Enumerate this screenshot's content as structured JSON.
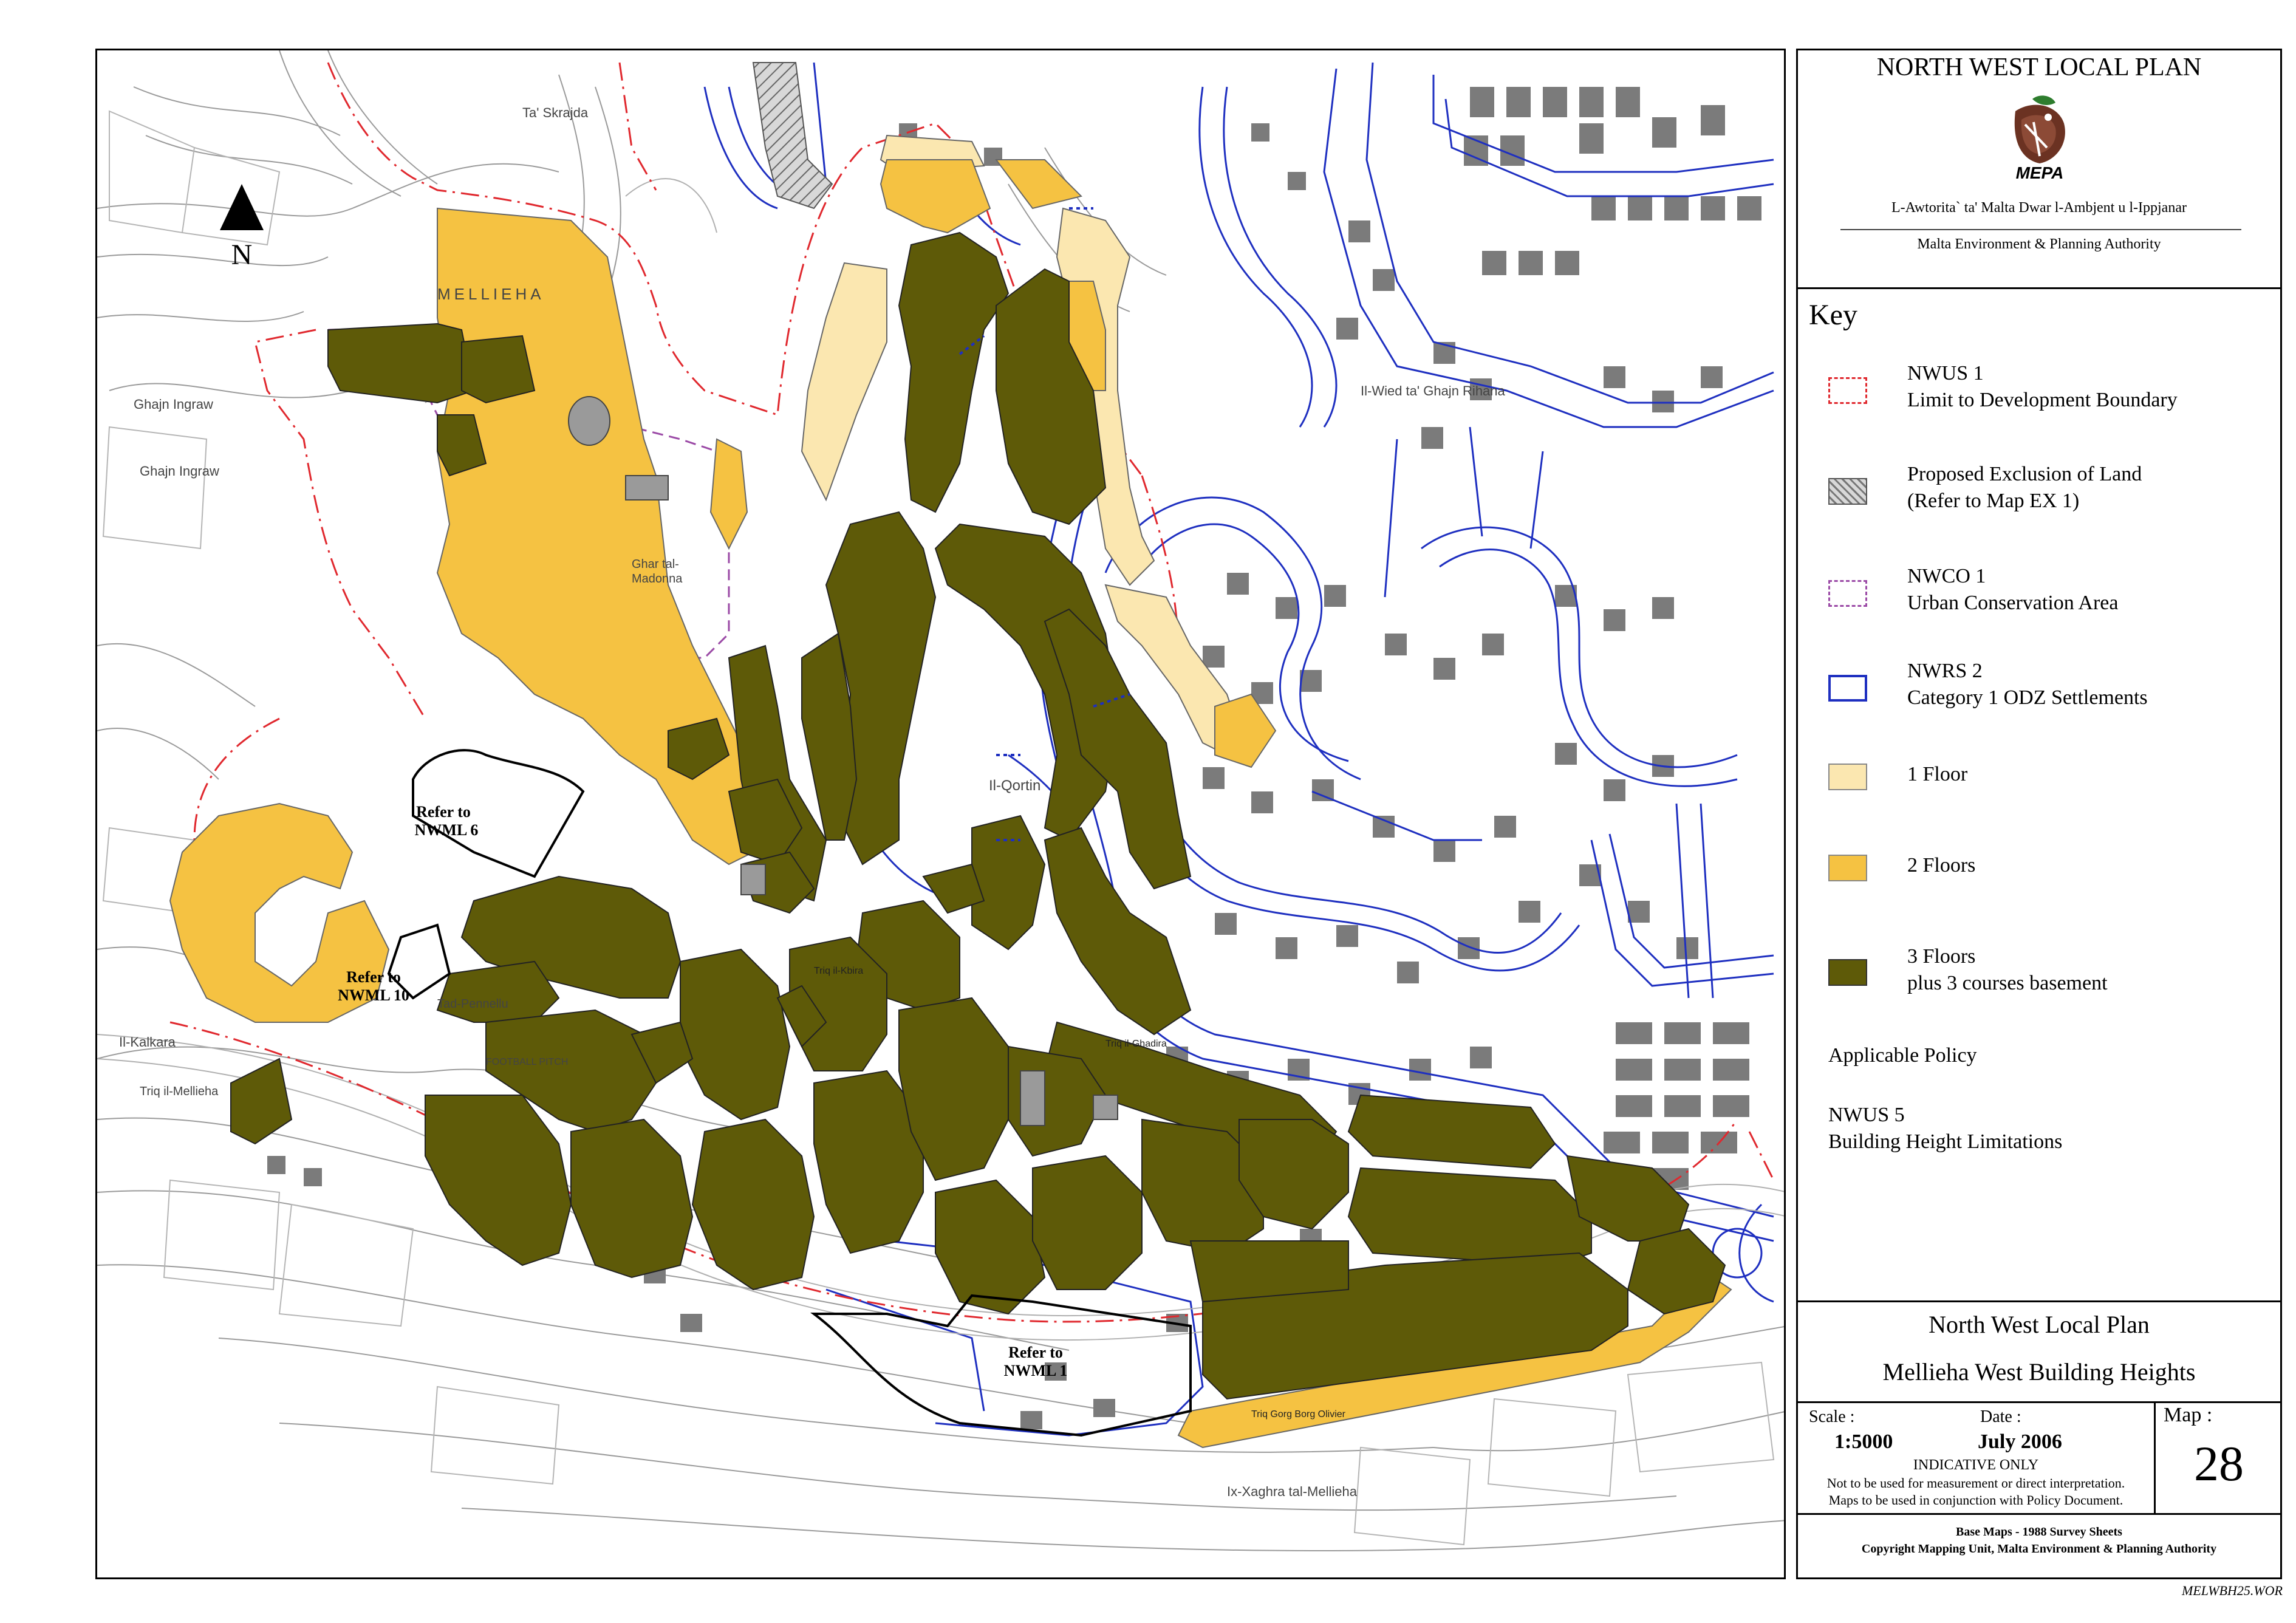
{
  "header": {
    "title": "NORTH WEST LOCAL PLAN",
    "logo_text": "MEPA",
    "authority_maltese": "L-Awtorita` ta' Malta Dwar l-Ambjent u l-Ippjanar",
    "authority_english": "Malta Environment & Planning Authority"
  },
  "key": {
    "heading": "Key",
    "items": [
      {
        "code": "NWUS 1",
        "label": "Limit to Development Boundary",
        "style": "dashed",
        "color": "#e0282e"
      },
      {
        "code": "Proposed Exclusion of Land",
        "label": "(Refer to Map EX 1)",
        "style": "hatched",
        "color": "#777777"
      },
      {
        "code": "NWCO 1",
        "label": "Urban Conservation Area",
        "style": "dashed",
        "color": "#9b4aa6"
      },
      {
        "code": "NWRS 2",
        "label": "Category 1 ODZ Settlements",
        "style": "outline",
        "color": "#1e2fc0"
      },
      {
        "code": "1 Floor",
        "label": "",
        "style": "fill",
        "color": "#fbe7b0"
      },
      {
        "code": "2 Floors",
        "label": "",
        "style": "fill",
        "color": "#f5c242"
      },
      {
        "code": "3 Floors",
        "label": "plus 3 courses basement",
        "style": "fill",
        "color": "#5e5a08"
      }
    ],
    "policy_heading": "Applicable Policy",
    "policy_code": "NWUS 5",
    "policy_label": "Building Height Limitations"
  },
  "plan": {
    "title": "North West Local Plan",
    "subtitle": "Mellieha West Building Heights"
  },
  "info": {
    "scale_label": "Scale :",
    "scale_value": "1:5000",
    "date_label": "Date :",
    "date_value": "July 2006",
    "indicative": "INDICATIVE ONLY",
    "note_1": "Not to be used for measurement or direct interpretation.",
    "note_2": "Maps to be used in conjunction with Policy Document.",
    "map_label": "Map :",
    "map_number": "28"
  },
  "credits": {
    "line_1": "Base Maps - 1988 Survey Sheets",
    "line_2": "Copyright Mapping Unit, Malta Environment & Planning Authority"
  },
  "file_code": "MELWBH25.WOR",
  "map": {
    "north_label": "N",
    "place_labels": {
      "mellieha": "MELLIEHA",
      "ghar_madonna_1": "Ghar tal-",
      "ghar_madonna_2": "Madonna",
      "il_qortin": "Il-Qortin",
      "ta_skrajda": "Ta' Skrajda",
      "ghajn_rihana": "Il-Wied ta' Ghajn Rihana",
      "ghajn_ingraw_1": "Ghajn Ingraw",
      "ghajn_ingraw_2": "Ghajn Ingraw",
      "il_kalkara": "Il-Kalkara",
      "tad_pennellu": "Tad-Pennellu",
      "sfuq": "Triq il-Mellieha",
      "football_pitch": "FOOTBALL PITCH",
      "ix_xaghra": "Ix-Xaghra tal-Mellieha",
      "triq_gorg": "Triq Gorg Borg Olivier",
      "triq_ghadira": "Triq il-Ghadira",
      "triq_kbira": "Triq il-Kbira"
    },
    "refer_labels": [
      {
        "line1": "Refer to",
        "line2": "NWML 6"
      },
      {
        "line1": "Refer to",
        "line2": "NWML 10"
      },
      {
        "line1": "Refer to",
        "line2": "NWML 1"
      }
    ],
    "colors": {
      "one_floor": "#fbe7b0",
      "two_floors": "#f5c242",
      "three_floors": "#5e5a08",
      "building_grey": "#7b7b7b",
      "odz_blue": "#1e2fc0",
      "boundary_red": "#e0282e",
      "conservation_purple": "#9b4aa6"
    }
  }
}
